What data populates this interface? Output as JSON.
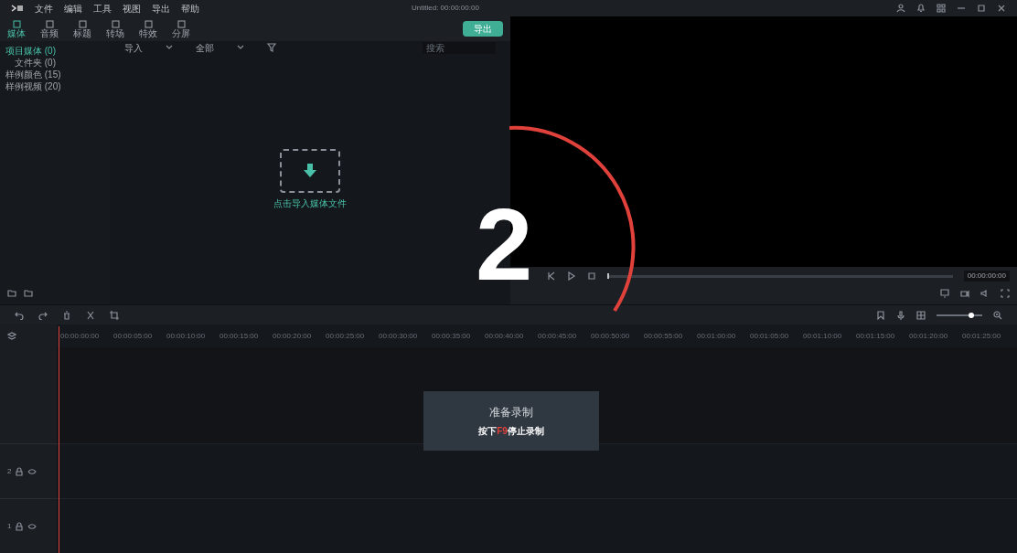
{
  "window": {
    "title": "Untitled: 00:00:00:00"
  },
  "menu": [
    "文件",
    "编辑",
    "工具",
    "视图",
    "导出",
    "帮助"
  ],
  "toolbar": [
    {
      "label": "媒体",
      "selected": true
    },
    {
      "label": "音频",
      "selected": false
    },
    {
      "label": "标题",
      "selected": false
    },
    {
      "label": "转场",
      "selected": false
    },
    {
      "label": "特效",
      "selected": false
    },
    {
      "label": "分屏",
      "selected": false
    }
  ],
  "export_button": "导出",
  "media_tree": [
    {
      "label": "项目媒体 (0)",
      "selected": true,
      "children": [
        {
          "label": "文件夹 (0)",
          "selected": false
        }
      ]
    },
    {
      "label": "样例颜色 (15)",
      "selected": false
    },
    {
      "label": "样例视频 (20)",
      "selected": false
    }
  ],
  "media_filter": {
    "sort": "导入",
    "view": "全部",
    "search_placeholder": "搜索"
  },
  "import_hint": "点击导入媒体文件",
  "preview": {
    "timecode": "00:00:00:00",
    "progress": {
      "level": 0
    },
    "zoom": {
      "level": 0.75
    }
  },
  "ruler": [
    "00:00:00:00",
    "00:00:05:00",
    "00:00:10:00",
    "00:00:15:00",
    "00:00:20:00",
    "00:00:25:00",
    "00:00:30:00",
    "00:00:35:00",
    "00:00:40:00",
    "00:00:45:00",
    "00:00:50:00",
    "00:00:55:00",
    "00:01:00:00",
    "00:01:05:00",
    "00:01:10:00",
    "00:01:15:00",
    "00:01:20:00",
    "00:01:25:00"
  ],
  "tracks": [
    {
      "label": "2"
    },
    {
      "label": "1"
    }
  ],
  "countdown": "2",
  "record_dialog": {
    "title": "准备录制",
    "hint": [
      {
        "text": "按下",
        "key": false
      },
      {
        "text": "F9",
        "key": true
      },
      {
        "text": "停止录制",
        "key": false
      }
    ]
  }
}
